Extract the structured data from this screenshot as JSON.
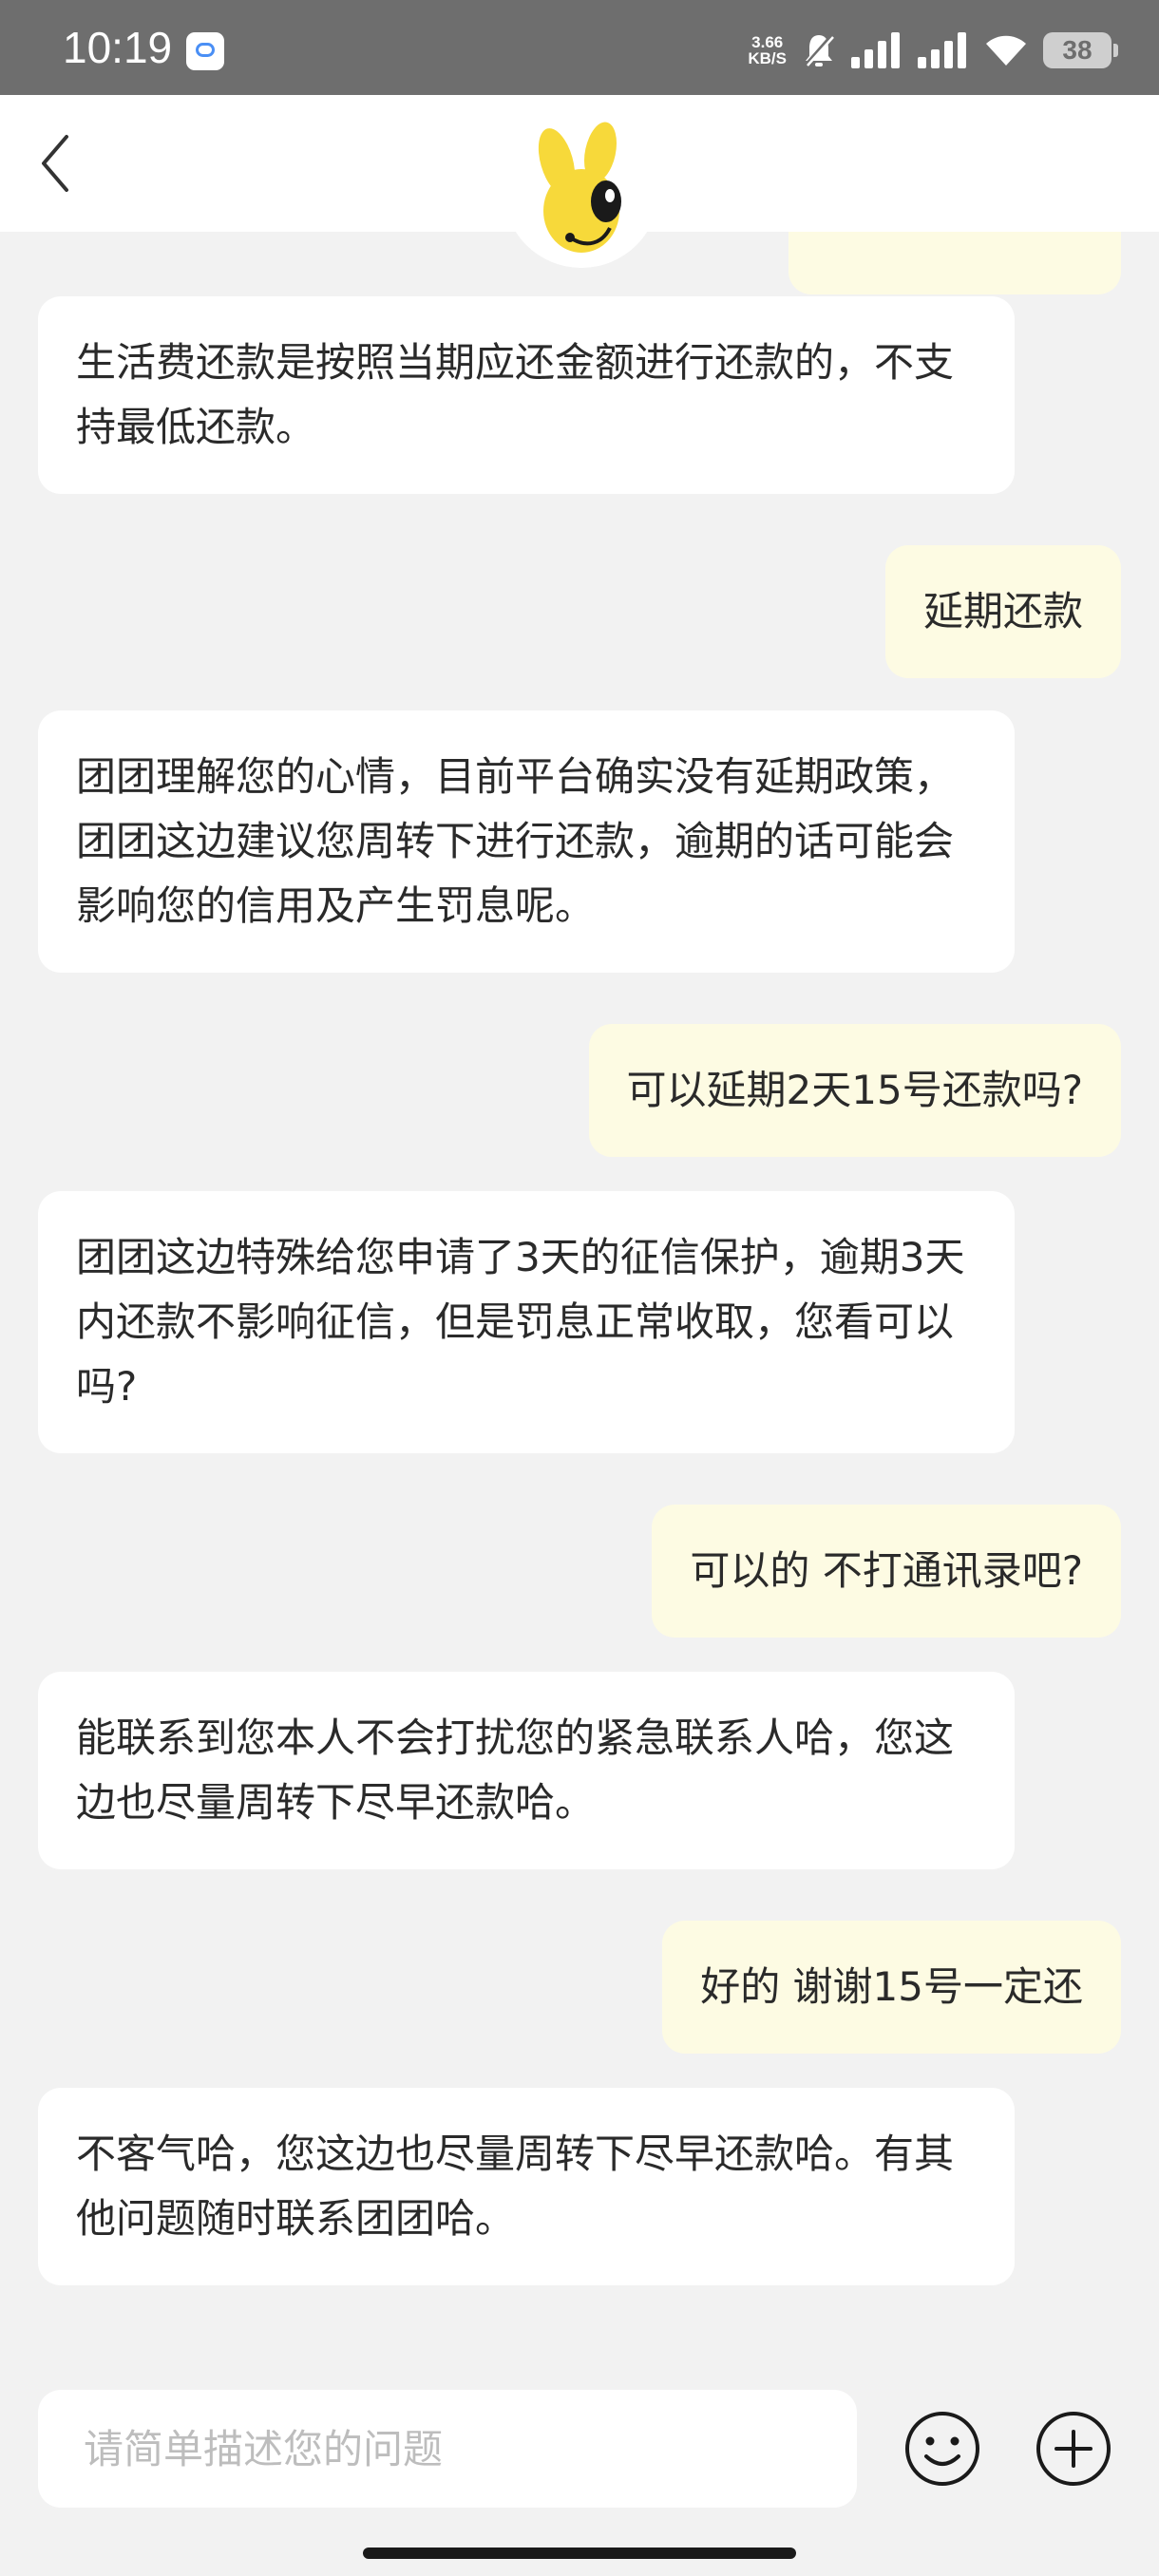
{
  "status_bar": {
    "time": "10:19",
    "net_speed_value": "3.66",
    "net_speed_unit": "KB/S",
    "battery": "38"
  },
  "messages": [
    {
      "role": "agent",
      "text": "生活费还款是按照当期应还金额进行还款的，不支持最低还款。"
    },
    {
      "role": "user",
      "text": "延期还款"
    },
    {
      "role": "agent",
      "text": "团团理解您的心情，目前平台确实没有延期政策，团团这边建议您周转下进行还款，逾期的话可能会影响您的信用及产生罚息呢。"
    },
    {
      "role": "user",
      "text": "可以延期2天15号还款吗?"
    },
    {
      "role": "agent",
      "text": "团团这边特殊给您申请了3天的征信保护，逾期3天内还款不影响征信，但是罚息正常收取，您看可以吗?"
    },
    {
      "role": "user",
      "text": "可以的 不打通讯录吧?"
    },
    {
      "role": "agent",
      "text": "能联系到您本人不会打扰您的紧急联系人哈，您这边也尽量周转下尽早还款哈。"
    },
    {
      "role": "user",
      "text": "好的 谢谢15号一定还"
    },
    {
      "role": "agent",
      "text": "不客气哈，您这边也尽量周转下尽早还款哈。有其他问题随时联系团团哈。"
    }
  ],
  "input": {
    "placeholder": "请简单描述您的问题"
  },
  "icons": {
    "back": "chevron-left-icon",
    "emoji": "smiley-icon",
    "plus": "plus-circle-icon"
  },
  "colors": {
    "user_bubble": "#fdfbe3",
    "agent_bubble": "#ffffff",
    "background": "#f2f2f2",
    "status_bar": "#6e6e6e",
    "mascot": "#f7d93a"
  }
}
